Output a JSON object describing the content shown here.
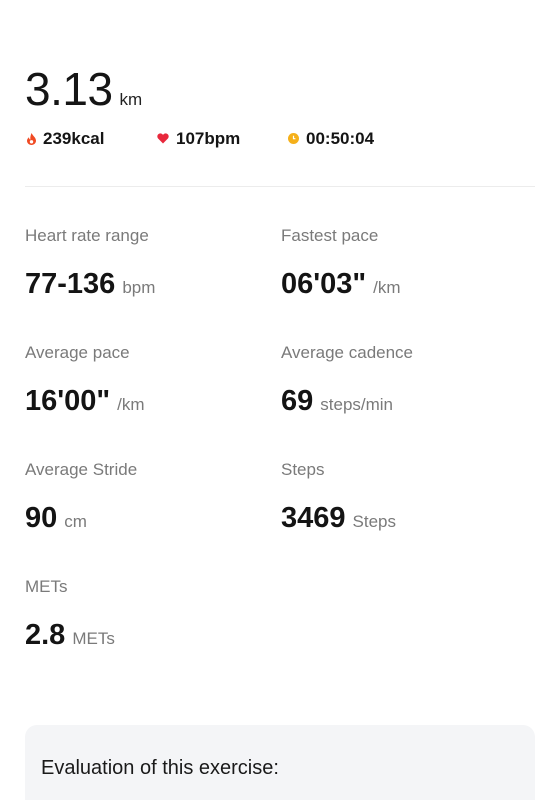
{
  "summary": {
    "distance_value": "3.13",
    "distance_unit": "km",
    "calories": "239kcal",
    "heart_rate": "107bpm",
    "duration": "00:50:04"
  },
  "metrics": {
    "heart_rate_range": {
      "label": "Heart rate range",
      "value": "77-136",
      "unit": "bpm"
    },
    "fastest_pace": {
      "label": "Fastest pace",
      "value": "06'03\"",
      "unit": "/km"
    },
    "average_pace": {
      "label": "Average pace",
      "value": "16'00\"",
      "unit": "/km"
    },
    "average_cadence": {
      "label": "Average cadence",
      "value": "69",
      "unit": "steps/min"
    },
    "average_stride": {
      "label": "Average Stride",
      "value": "90",
      "unit": "cm"
    },
    "steps": {
      "label": "Steps",
      "value": "3469",
      "unit": "Steps"
    },
    "mets": {
      "label": "METs",
      "value": "2.8",
      "unit": "METs"
    }
  },
  "evaluation": {
    "title": "Evaluation of this exercise:"
  },
  "icons": {
    "calories": "flame-icon",
    "heart_rate": "heart-icon",
    "duration": "clock-dot-icon"
  },
  "colors": {
    "flame": "#f04a23",
    "heart": "#e8283c",
    "clock": "#f5b01a"
  }
}
